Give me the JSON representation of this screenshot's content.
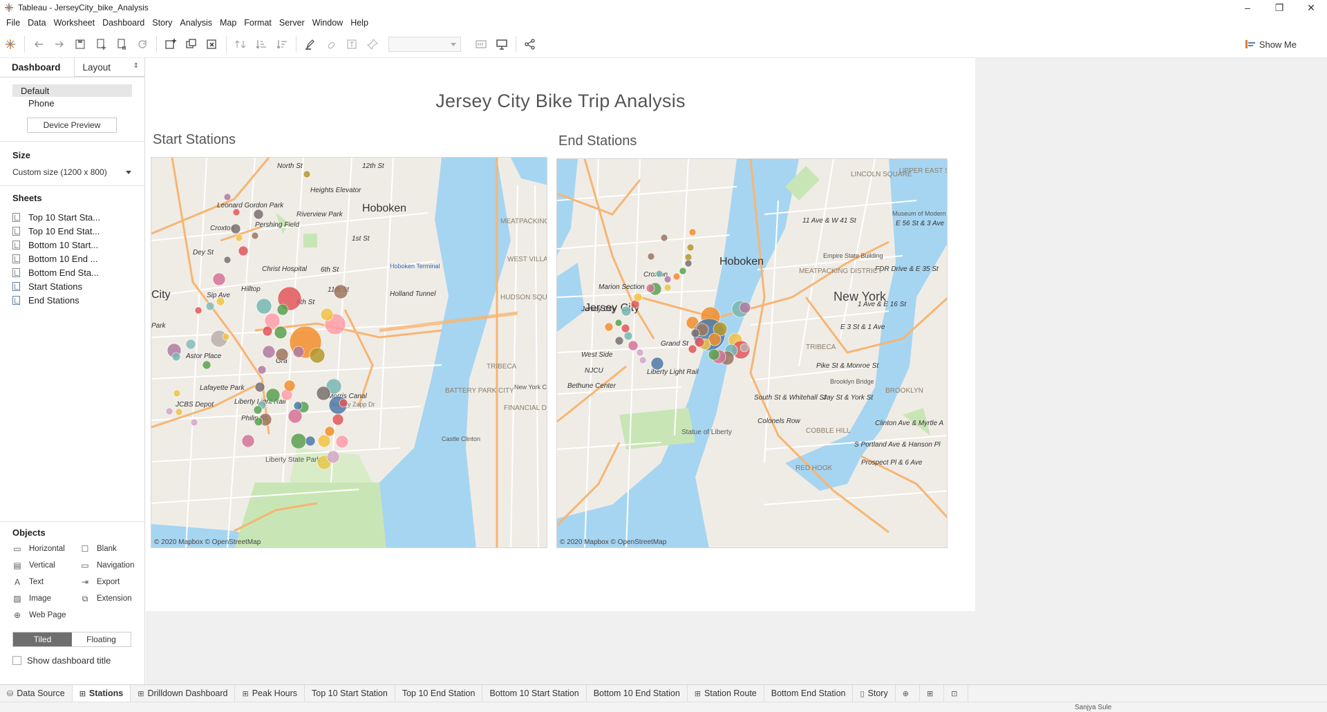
{
  "window": {
    "title": "Tableau - JerseyCity_bike_Analysis",
    "minimize": "–",
    "restore": "❐",
    "close": "✕"
  },
  "menu": [
    "File",
    "Data",
    "Worksheet",
    "Dashboard",
    "Story",
    "Analysis",
    "Map",
    "Format",
    "Server",
    "Window",
    "Help"
  ],
  "toolbar": {
    "show_me_label": "Show Me",
    "icons": [
      "tableau-logo-icon",
      "undo-icon",
      "redo-icon",
      "save-icon",
      "new-datasource-icon",
      "pause-updates-icon",
      "refresh-icon",
      "new-sheet-icon",
      "duplicate-icon",
      "clear-icon",
      "swap-icon",
      "sort-asc-icon",
      "sort-desc-icon",
      "highlight-icon",
      "group-icon",
      "labels-icon",
      "pin-icon",
      "fit-icon",
      "presentation-icon",
      "share-icon"
    ]
  },
  "left_panel": {
    "tab_dashboard": "Dashboard",
    "tab_layout": "Layout",
    "devices": [
      "Default",
      "Phone"
    ],
    "device_preview": "Device Preview",
    "size_title": "Size",
    "size_value": "Custom size (1200 x 800)",
    "sheets_title": "Sheets",
    "sheets": [
      "Top 10 Start Sta...",
      "Top 10 End Stat...",
      "Bottom 10 Start...",
      "Bottom 10 End ...",
      "Bottom End Sta...",
      "Start Stations",
      "End Stations"
    ],
    "objects_title": "Objects",
    "objects": [
      "Horizontal",
      "Blank",
      "Vertical",
      "Navigation",
      "Text",
      "Export",
      "Image",
      "Extension",
      "Web Page"
    ],
    "tiled": "Tiled",
    "floating": "Floating",
    "show_dashboard_title": "Show dashboard title"
  },
  "dashboard": {
    "title": "Jersey City Bike Trip Analysis",
    "start_title": "Start Stations",
    "end_title": "End Stations",
    "attribution": "© 2020 Mapbox © OpenStreetMap"
  },
  "start_map": {
    "labels": [
      "North St",
      "12th St",
      "Heights Elevator",
      "Hoboken",
      "Leonard Gordon Park",
      "Riverview Park",
      "Pershing Field",
      "1st St",
      "Croxton",
      "MEATPACKING DISTRICT",
      "Dey St",
      "WEST VILLAGE",
      "Christ Hospital",
      "Hoboken Terminal",
      "11th St",
      "6th St",
      "Hilltop",
      "Sip Ave",
      "Holland Tunnel",
      "HUDSON SQUARE",
      "City",
      "8th St",
      "Park",
      "TRIBECA",
      "Astor Place",
      "Morris Canal",
      "BATTERY PARK CITY",
      "Lafayette Park",
      "FINANCIAL DISTRICT",
      "JCBS Depot",
      "Liberty Light Rail",
      "Audrey Zapp Dr",
      "New York City Hall",
      "Liberty State Park",
      "Castle Clinton",
      "Philip St",
      "Gra"
    ]
  },
  "end_map": {
    "labels": [
      "LINCOLN SQUARE",
      "UPPER EAST SIDE",
      "11 Ave & W 41 St",
      "E 56 St & 3 Ave",
      "Hoboken",
      "Croxton",
      "Marion Section",
      "Jersey City",
      "FDR Drive & E 35 St",
      "New York",
      "1 Ave & E 16 St",
      "E 3 St & 1 Ave",
      "West Side",
      "NJCU",
      "Liberty Light Rail",
      "Pike St & Monroe St",
      "Bethune Center",
      "South St & Whitehall St",
      "Jay St & York St",
      "Clinton Ave & Myrtle A",
      "S Portland Ave & Hanson Pl",
      "Prospect Pl & 6 Ave",
      "Colonels Row",
      "Statue of Liberty",
      "COBBLE HILL",
      "RED HOOK",
      "Brooklyn Bridge",
      "BROOKLYN",
      "TRIBECA",
      "Empire State Building",
      "MEATPACKING DISTRICT",
      "Museum of Modern Art",
      "Grand St",
      "Jersey City"
    ]
  },
  "colors": {
    "water": "#a6d5f1",
    "land": "#efece6",
    "park": "#c8e6b5",
    "road_major": "#f7b572",
    "road_minor": "#ffffff",
    "accent_tab": "#6e6e6e"
  },
  "bottom_tabs": [
    "Data Source",
    "Stations",
    "Drilldown Dashboard",
    "Peak Hours",
    "Top 10 Start Station",
    "Top 10 End Station",
    "Bottom 10 Start Station",
    "Bottom 10 End Station",
    "Station Route",
    "Bottom End Station",
    "Story"
  ],
  "status": {
    "user": "Sanjya Sule"
  }
}
